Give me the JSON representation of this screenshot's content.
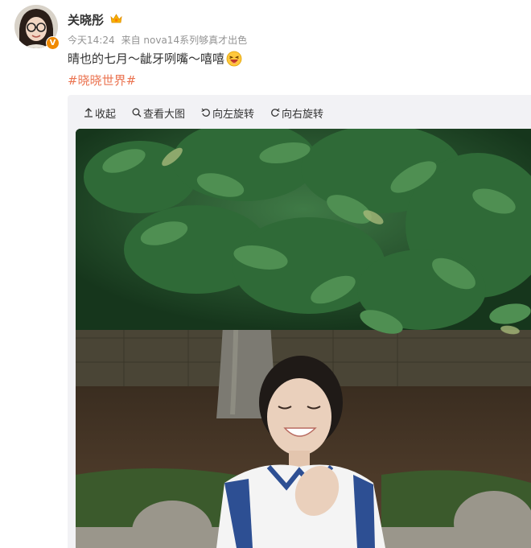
{
  "post": {
    "username": "关晓彤",
    "time": "今天14:24",
    "source": "来自 nova14系列够真才出色",
    "text": "晴也的七月～龇牙咧嘴～嘻嘻",
    "hashtag": "#晓晓世界#"
  },
  "toolbar": {
    "collapse": "收起",
    "view_large": "查看大图",
    "rotate_left": "向左旋转",
    "rotate_right": "向右旋转"
  },
  "icons": {
    "avatar": "user-avatar",
    "verified": "verified-badge-icon",
    "crown": "crown-icon",
    "emoji": "laughing-emoji-icon",
    "collapse": "arrow-up-icon",
    "view_large": "magnifier-icon",
    "rotate_left": "rotate-left-icon",
    "rotate_right": "rotate-right-icon"
  },
  "colors": {
    "hashtag": "#eb7350",
    "meta": "#939393",
    "panel": "#f2f2f5",
    "verified": "#f08a00"
  }
}
